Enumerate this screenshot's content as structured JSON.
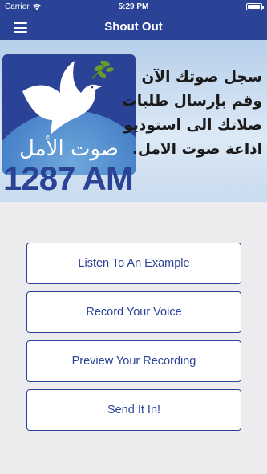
{
  "status_bar": {
    "carrier": "Carrier",
    "time": "5:29 PM",
    "wifi_icon": "wifi-icon",
    "battery_icon": "battery-icon"
  },
  "nav": {
    "title": "Shout Out",
    "menu_icon": "hamburger-menu-icon",
    "color": "#2a4396"
  },
  "banner": {
    "logo_arabic": "صوت الأمل",
    "frequency": "1287 AM",
    "text_lines": [
      "سجل صوتك الآن",
      "وقم بإرسال طلبات",
      "صلاتك الى استوديو",
      "اذاعة صوت الامل."
    ]
  },
  "buttons": [
    {
      "label": "Listen To An Example"
    },
    {
      "label": "Record Your Voice"
    },
    {
      "label": "Preview Your Recording"
    },
    {
      "label": "Send It In!"
    }
  ]
}
